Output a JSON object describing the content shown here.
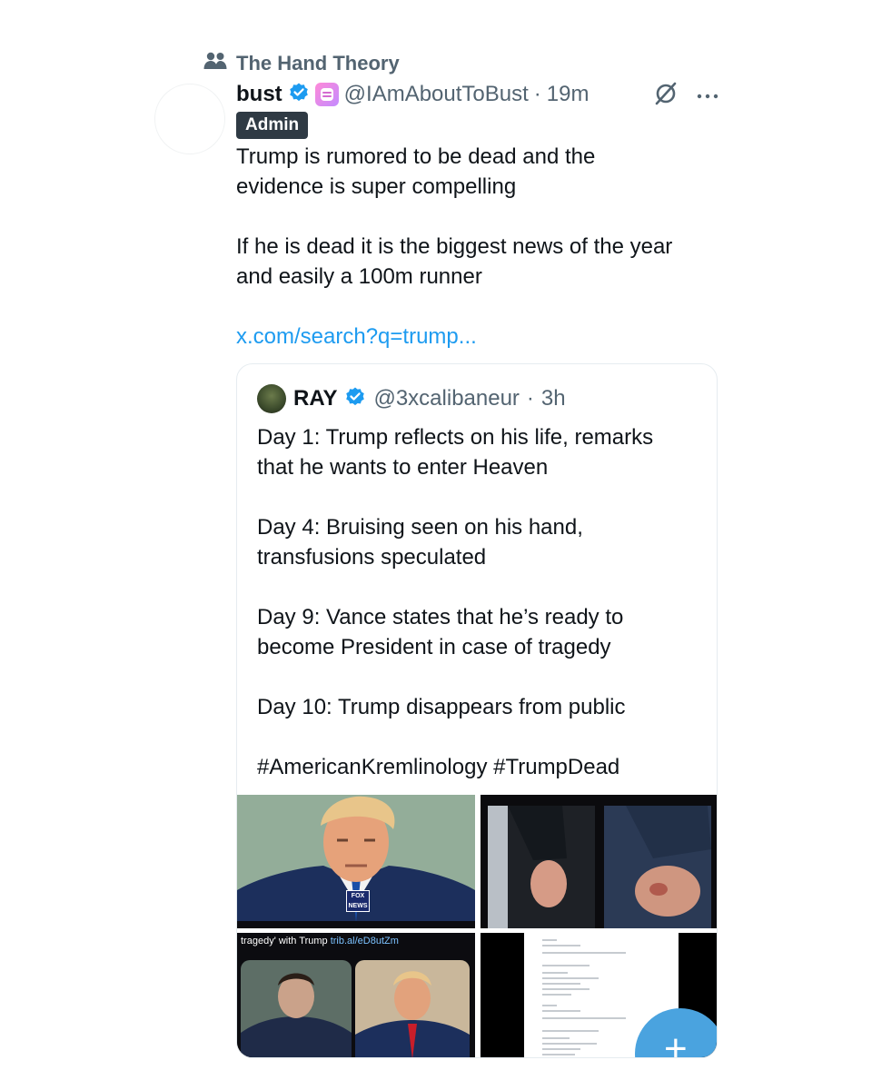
{
  "community": {
    "name": "The Hand Theory",
    "icon": "people-icon"
  },
  "post": {
    "author_name": "bust",
    "handle": "@IAmAboutToBust",
    "separator": "·",
    "time": "19m",
    "role_badge": "Admin",
    "text": {
      "p1_line1": "Trump is rumored to be dead and the",
      "p1_line2": "evidence is super compelling",
      "p2_line1": "If he is dead it is the biggest news of the year",
      "p2_line2": "and easily a 100m runner",
      "link": "x.com/search?q=trump..."
    },
    "icons": {
      "verified": "verified-badge-icon",
      "affiliate": "affiliate-badge-icon",
      "grok": "grok-icon",
      "more": "more-icon"
    },
    "colors": {
      "accent": "#1d9bf0",
      "secondary_text": "#536471",
      "badge_bg": "#2f3a44"
    }
  },
  "quote": {
    "author_name": "RAY",
    "handle": "@3xcalibaneur",
    "separator": "·",
    "time": "3h",
    "lines": {
      "l1": "Day 1: Trump reflects on his life, remarks",
      "l2": "that he wants to enter Heaven",
      "l3": "Day 4: Bruising seen on his hand,",
      "l4": "transfusions speculated",
      "l5": "Day 9: Vance states that he’s ready to",
      "l6": "become President in case of tragedy",
      "l7": "Day 10: Trump disappears from public",
      "l8": "#AmericanKremlinology #TrumpDead"
    },
    "media": {
      "caption_text": "tragedy' with Trump ",
      "caption_link": "trib.al/eD8utZm",
      "fox_logo": "FOX NEWS"
    }
  }
}
